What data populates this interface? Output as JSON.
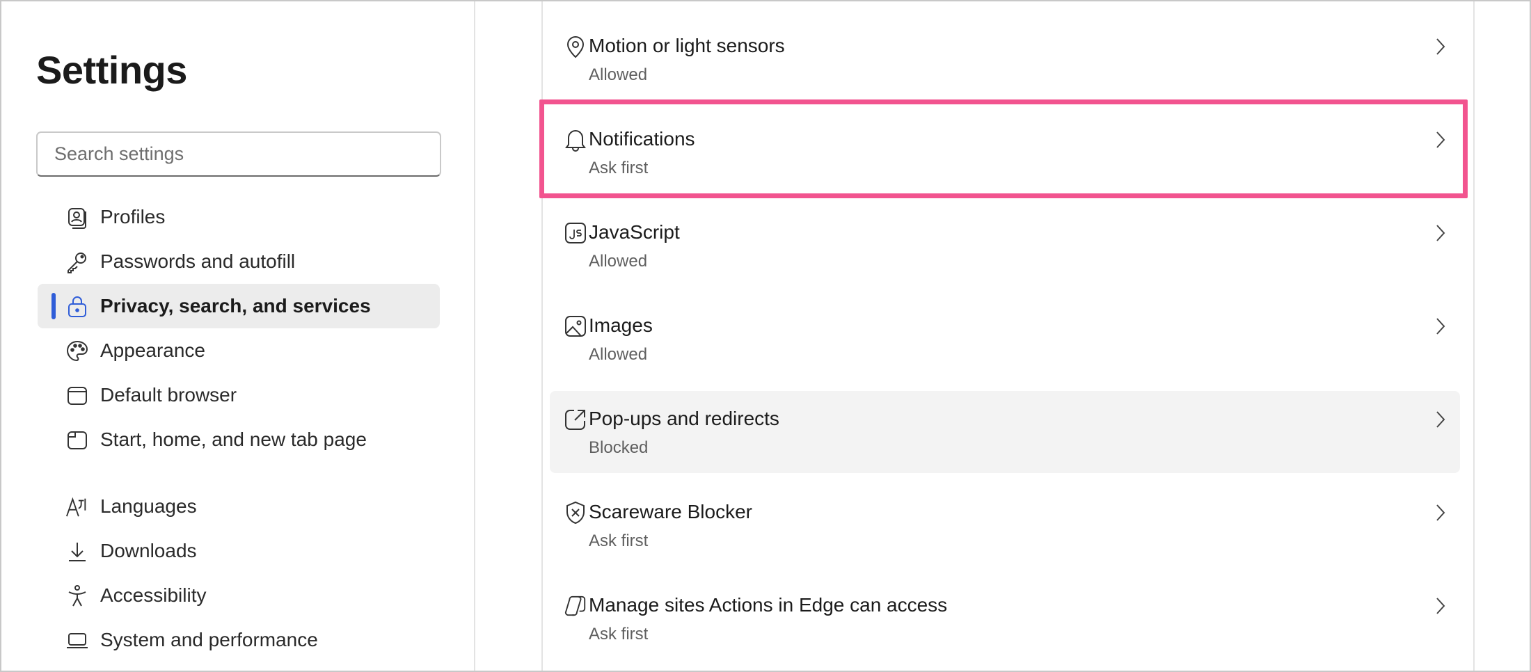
{
  "sidebar": {
    "title": "Settings",
    "search": {
      "placeholder": "Search settings",
      "value": ""
    },
    "items": [
      {
        "label": "Profiles",
        "icon": "profiles-icon",
        "active": false
      },
      {
        "label": "Passwords and autofill",
        "icon": "key-icon",
        "active": false
      },
      {
        "label": "Privacy, search, and services",
        "icon": "lock-icon",
        "active": true
      },
      {
        "label": "Appearance",
        "icon": "palette-icon",
        "active": false
      },
      {
        "label": "Default browser",
        "icon": "browser-icon",
        "active": false
      },
      {
        "label": "Start, home, and new tab page",
        "icon": "new-tab-icon",
        "active": false
      },
      {
        "label": "Languages",
        "icon": "languages-icon",
        "active": false
      },
      {
        "label": "Downloads",
        "icon": "download-icon",
        "active": false
      },
      {
        "label": "Accessibility",
        "icon": "accessibility-icon",
        "active": false
      },
      {
        "label": "System and performance",
        "icon": "laptop-icon",
        "active": false
      }
    ],
    "accent_color": "#2f5dd8"
  },
  "permissions": [
    {
      "title": "Motion or light sensors",
      "status": "Allowed",
      "icon": "location-pin-icon"
    },
    {
      "title": "Notifications",
      "status": "Ask first",
      "icon": "bell-icon",
      "highlighted": true
    },
    {
      "title": "JavaScript",
      "status": "Allowed",
      "icon": "javascript-icon"
    },
    {
      "title": "Images",
      "status": "Allowed",
      "icon": "image-icon"
    },
    {
      "title": "Pop-ups and redirects",
      "status": "Blocked",
      "icon": "external-link-icon",
      "hovered": true
    },
    {
      "title": "Scareware Blocker",
      "status": "Ask first",
      "icon": "shield-x-icon"
    },
    {
      "title": "Manage sites Actions in Edge can access",
      "status": "Ask first",
      "icon": "copilot-icon"
    }
  ],
  "highlight_color": "#f2548f"
}
